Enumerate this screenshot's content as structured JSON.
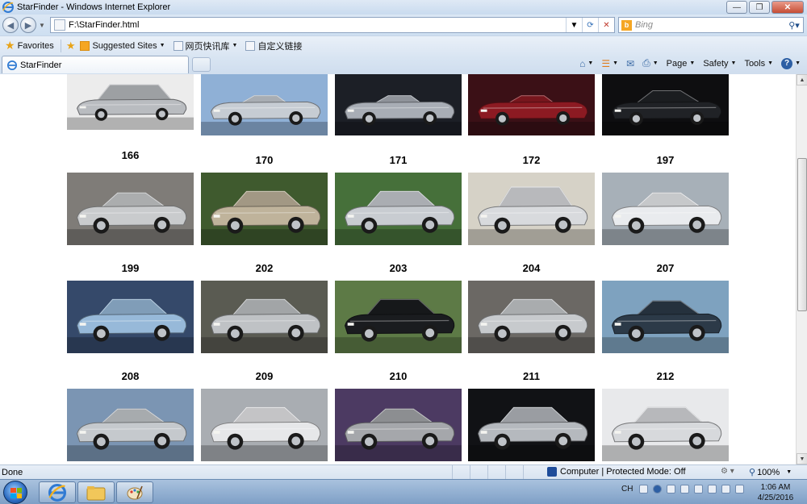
{
  "window": {
    "title": "StarFinder - Windows Internet Explorer"
  },
  "window_controls": {
    "minimize": "—",
    "restore": "❐",
    "close": "✕"
  },
  "address": {
    "url": "F:\\StarFinder.html",
    "search_placeholder": "Bing",
    "refresh_icon": "⟳",
    "stop_icon": "✕"
  },
  "favorites_bar": {
    "favorites_label": "Favorites",
    "items": [
      {
        "label": "Suggested Sites",
        "icon": "bing-icon"
      },
      {
        "label": "网页快讯库",
        "icon": "web-slice-icon"
      },
      {
        "label": "自定义链接",
        "icon": "page-icon"
      }
    ]
  },
  "tabs": [
    {
      "label": "StarFinder"
    }
  ],
  "command_bar": {
    "home_icon": "⌂",
    "feeds_icon": "☰",
    "mail_icon": "✉",
    "print_icon": "⎙",
    "page_label": "Page",
    "safety_label": "Safety",
    "tools_label": "Tools",
    "help_label": "?"
  },
  "gallery": {
    "rows": [
      {
        "cars": [
          {
            "label": "",
            "bg": "#ececec",
            "body": "#b9bcc0",
            "style": "suv"
          },
          {
            "label": "",
            "bg": "#8fb0d6",
            "body": "#c6ccd3",
            "style": "convertible"
          },
          {
            "label": "",
            "bg": "#1c1f26",
            "body": "#a8adb5",
            "style": "roadster"
          },
          {
            "label": "",
            "bg": "#3b1016",
            "body": "#8c1a22",
            "style": "roadster"
          },
          {
            "label": "",
            "bg": "#0e0e10",
            "body": "#202226",
            "style": "coupe"
          }
        ]
      },
      {
        "cars": [
          {
            "label": "166",
            "bg": "#7f7c78",
            "body": "#c9cbcd",
            "style": "coupe"
          },
          {
            "label": "170",
            "bg": "#3f5a2e",
            "body": "#bfb39b",
            "style": "sedan"
          },
          {
            "label": "171",
            "bg": "#46703a",
            "body": "#c8ccd1",
            "style": "sedan"
          },
          {
            "label": "172",
            "bg": "#d6d2c7",
            "body": "#d8dadd",
            "style": "suv"
          },
          {
            "label": "197",
            "bg": "#a7b0b8",
            "body": "#e9ebee",
            "style": "coupe"
          }
        ]
      },
      {
        "cars": [
          {
            "label": "199",
            "bg": "#35496a",
            "body": "#97b9d9",
            "style": "sedan"
          },
          {
            "label": "202",
            "bg": "#5a5b52",
            "body": "#bfc2c5",
            "style": "sedan"
          },
          {
            "label": "203",
            "bg": "#5d7a46",
            "body": "#1a1c1f",
            "style": "sedan"
          },
          {
            "label": "204",
            "bg": "#6b6864",
            "body": "#c7cacd",
            "style": "sedan"
          },
          {
            "label": "207",
            "bg": "#7ea2bf",
            "body": "#2c3a48",
            "style": "coupe"
          }
        ]
      },
      {
        "cars": [
          {
            "label": "208",
            "bg": "#7b95b3",
            "body": "#c5c9cd",
            "style": "coupe"
          },
          {
            "label": "209",
            "bg": "#a9adb2",
            "body": "#e6e7e9",
            "style": "sedan"
          },
          {
            "label": "210",
            "bg": "#4c3a62",
            "body": "#a5a7ab",
            "style": "coupe"
          },
          {
            "label": "211",
            "bg": "#111215",
            "body": "#b5b9be",
            "style": "sedan"
          },
          {
            "label": "212",
            "bg": "#e8e9eb",
            "body": "#d7d9dc",
            "style": "sedan"
          }
        ]
      }
    ]
  },
  "status": {
    "text": "Done",
    "zone": "Computer | Protected Mode: Off",
    "zoom": "100%"
  },
  "taskbar": {
    "items": [
      {
        "name": "ie-taskbar-button"
      },
      {
        "name": "explorer-taskbar-button"
      },
      {
        "name": "paint-taskbar-button"
      }
    ],
    "tray_lang": "CH",
    "time": "1:06 AM",
    "date": "4/25/2016"
  }
}
